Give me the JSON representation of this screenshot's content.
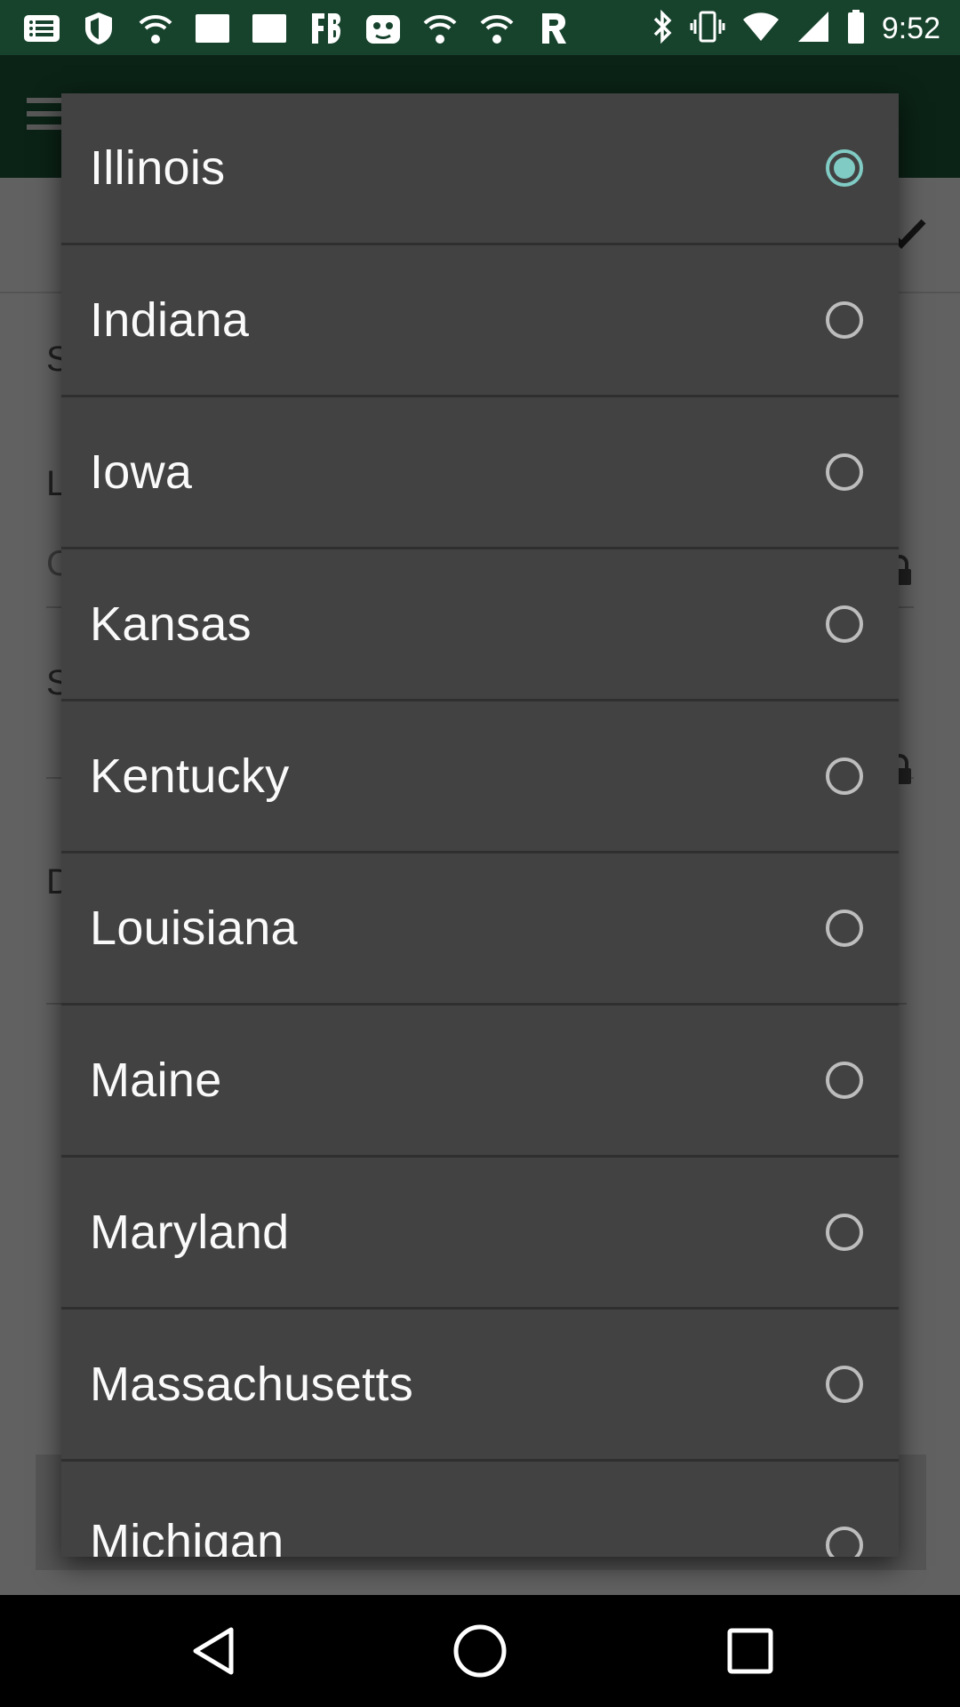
{
  "status_bar": {
    "time": "9:52",
    "left_icons": [
      "messages-icon",
      "shield-icon",
      "wifi-icon",
      "blank-card-icon",
      "blank-card-icon",
      "fb-icon",
      "cat-face-icon",
      "wifi-icon",
      "wifi-icon",
      "r-app-icon"
    ],
    "right_icons": [
      "bluetooth-icon",
      "vibrate-icon",
      "wifi-signal-icon",
      "cell-signal-icon",
      "battery-icon"
    ]
  },
  "background_app": {
    "colors": {
      "toolbar": "#1f5a3c",
      "status_bar": "#17432d"
    },
    "visible_fragments": [
      "S",
      "L",
      "C",
      "S",
      "D"
    ]
  },
  "dialog": {
    "options": [
      {
        "label": "Illinois",
        "selected": true
      },
      {
        "label": "Indiana",
        "selected": false
      },
      {
        "label": "Iowa",
        "selected": false
      },
      {
        "label": "Kansas",
        "selected": false
      },
      {
        "label": "Kentucky",
        "selected": false
      },
      {
        "label": "Louisiana",
        "selected": false
      },
      {
        "label": "Maine",
        "selected": false
      },
      {
        "label": "Maryland",
        "selected": false
      },
      {
        "label": "Massachusetts",
        "selected": false
      },
      {
        "label": "Michigan",
        "selected": false
      }
    ],
    "colors": {
      "background": "#424242",
      "text": "#fafafa",
      "radio_selected": "#80cbc4",
      "radio_unselected": "#bdbdbd"
    }
  },
  "nav_bar": {
    "buttons": [
      "back-icon",
      "home-icon",
      "recents-icon"
    ]
  }
}
